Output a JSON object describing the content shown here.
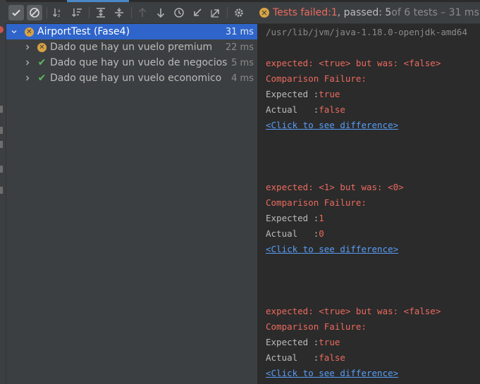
{
  "toolbar": {
    "buttons": [
      {
        "icon": "show-passed-icon",
        "active": true
      },
      {
        "icon": "show-ignored-icon",
        "active": true
      },
      {
        "icon": "sort-alphabetically-icon"
      },
      {
        "icon": "sort-by-duration-icon"
      },
      {
        "icon": "expand-all-icon"
      },
      {
        "icon": "collapse-all-icon"
      },
      {
        "icon": "previous-failed-icon"
      },
      {
        "icon": "next-failed-icon"
      },
      {
        "icon": "test-history-icon"
      },
      {
        "icon": "import-tests-icon"
      },
      {
        "icon": "export-tests-icon"
      },
      {
        "icon": "settings-icon"
      }
    ]
  },
  "status": {
    "failed_label": "Tests failed: ",
    "failed_count": "1",
    "passed_label": ", passed: 5",
    "total": " of 6 tests – 31 ms"
  },
  "tree": {
    "root": {
      "label": "AirportTest (Fase4)",
      "time": "31 ms",
      "status": "failed"
    },
    "children": [
      {
        "label": "Dado que hay un vuelo premium",
        "time": "22 ms",
        "status": "failed"
      },
      {
        "label": "Dado que hay un vuelo de negocios",
        "time": "5 ms",
        "status": "passed"
      },
      {
        "label": "Dado que hay un vuelo economico",
        "time": "4 ms",
        "status": "passed"
      }
    ]
  },
  "console": {
    "command": "/usr/lib/jvm/java-1.18.0-openjdk-amd64",
    "failures": [
      {
        "message": "expected: <true> but was: <false>",
        "title": "Comparison Failure:",
        "expected_label": "Expected :",
        "expected": "true",
        "actual_label": "Actual   :",
        "actual": "false",
        "link": "<Click to see difference>"
      },
      {
        "message": "expected: <1> but was: <0>",
        "title": "Comparison Failure:",
        "expected_label": "Expected :",
        "expected": "1",
        "actual_label": "Actual   :",
        "actual": "0",
        "link": "<Click to see difference>"
      },
      {
        "message": "expected: <true> but was: <false>",
        "title": "Comparison Failure:",
        "expected_label": "Expected :",
        "expected": "true",
        "actual_label": "Actual   :",
        "actual": "false",
        "link": "<Click to see difference>"
      }
    ]
  },
  "colors": {
    "accent": "#2f65ca",
    "error": "#ec6a5e",
    "pass": "#5fb760",
    "warn": "#d9a343",
    "link": "#589df6"
  }
}
